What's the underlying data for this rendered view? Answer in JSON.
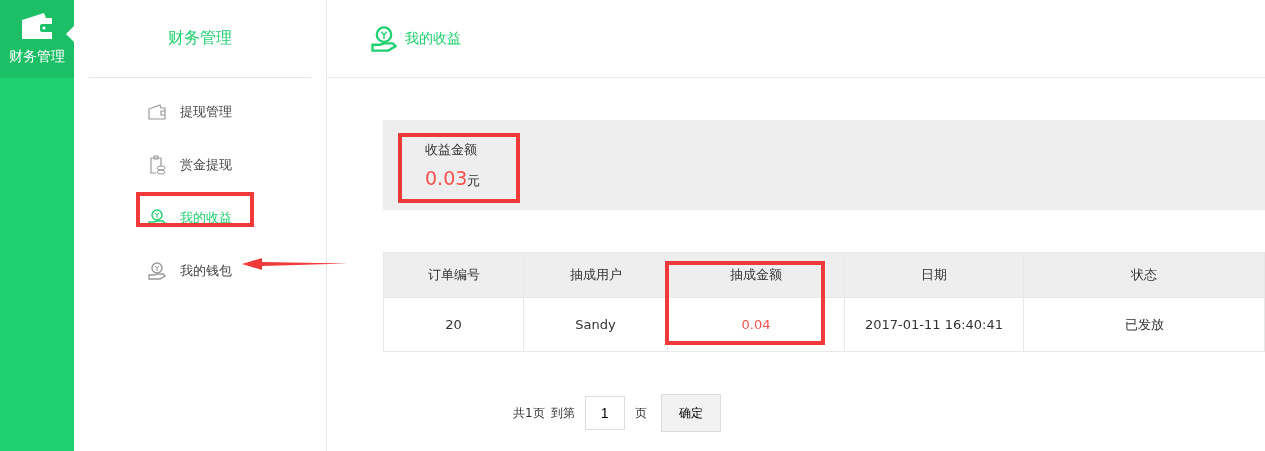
{
  "rail": {
    "label": "财务管理",
    "selected": true
  },
  "sidebar": {
    "title": "财务管理",
    "items": [
      {
        "label": "提现管理",
        "kind": "wallet",
        "selected": false
      },
      {
        "label": "赏金提现",
        "kind": "coins",
        "selected": false
      },
      {
        "label": "我的收益",
        "kind": "hand",
        "selected": true
      },
      {
        "label": "我的钱包",
        "kind": "hand",
        "selected": false
      }
    ]
  },
  "header": {
    "title": "我的收益"
  },
  "summary": {
    "label": "收益金额",
    "amount": "0.03",
    "unit": "元"
  },
  "table": {
    "columns": [
      {
        "label": "订单编号",
        "kind": "text"
      },
      {
        "label": "抽成用户",
        "kind": "text"
      },
      {
        "label": "抽成金额",
        "kind": "amount"
      },
      {
        "label": "日期",
        "kind": "text"
      },
      {
        "label": "状态",
        "kind": "text"
      }
    ],
    "rows": [
      [
        "20",
        "Sandy",
        "0.04",
        "2017-01-11 16:40:41",
        "已发放"
      ]
    ]
  },
  "pagination": {
    "total": "共1页",
    "goto": "到第",
    "page": "1",
    "unit": "页",
    "confirm": "确定"
  }
}
